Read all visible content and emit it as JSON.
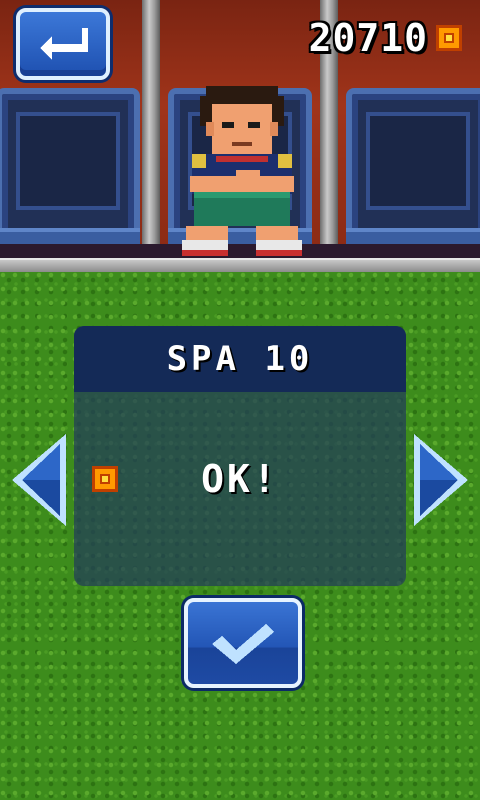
{
  "hud": {
    "coins": "20710",
    "back_icon": "return-arrow-icon",
    "coin_icon": "coin-icon"
  },
  "scene": {
    "backdrop": "stadium-dugout",
    "character": "pixel-footballer-seated"
  },
  "dialog": {
    "title": "SPA 10",
    "status": "OK!",
    "cost_icon": "coin-icon"
  },
  "navigation": {
    "prev_icon": "arrow-left-icon",
    "next_icon": "arrow-right-icon"
  },
  "confirm": {
    "icon": "checkmark-icon"
  },
  "colors": {
    "button_blue": "#2356b6",
    "panel_header": "#142a57",
    "coin_orange": "#ff9a00",
    "grass_green": "#3d8c1c"
  }
}
